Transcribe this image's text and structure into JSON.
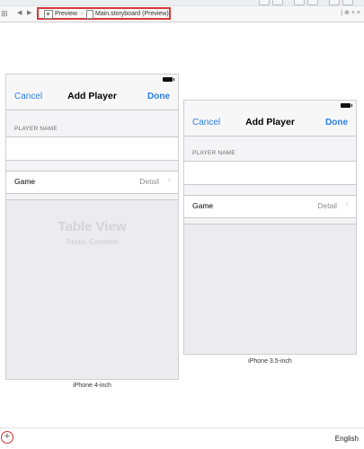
{
  "jump_bar": {
    "grid_icon": "⊞",
    "back_icon": "◀",
    "forward_icon": "▶",
    "crumbs": [
      "Preview",
      "Main.storyboard (Preview)"
    ],
    "chevron": "›",
    "right_text": "| ⊕ + ×"
  },
  "devices": [
    {
      "label": "iPhone 4-inch",
      "nav": {
        "cancel": "Cancel",
        "title": "Add Player",
        "done": "Done"
      },
      "section_header": "PLAYER NAME",
      "name_value": "",
      "game_cell": {
        "title": "Game",
        "detail": "Detail",
        "chevron": "›"
      },
      "table_view": {
        "title": "Table View",
        "subtitle": "Static Content"
      }
    },
    {
      "label": "iPhone 3.5-inch",
      "nav": {
        "cancel": "Cancel",
        "title": "Add Player",
        "done": "Done"
      },
      "section_header": "PLAYER NAME",
      "name_value": "",
      "game_cell": {
        "title": "Game",
        "detail": "Detail",
        "chevron": "›"
      }
    }
  ],
  "bottom": {
    "add_label": "+",
    "language": "English"
  },
  "colors": {
    "ios_blue": "#2a7ee0",
    "highlight_red": "#d63a3a"
  }
}
